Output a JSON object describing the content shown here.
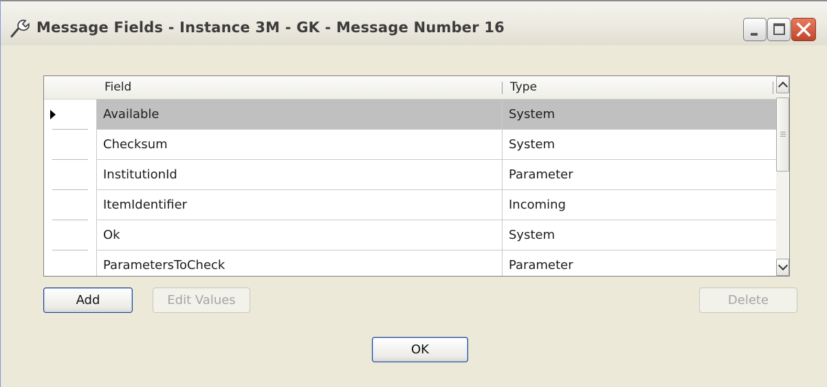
{
  "window": {
    "title": "Message Fields - Instance 3M - GK - Message Number 16",
    "icon": "tools-icon"
  },
  "grid": {
    "columns": [
      "Field",
      "Type"
    ],
    "selected_row": 0,
    "rows": [
      {
        "field": "Available",
        "type": "System"
      },
      {
        "field": "Checksum",
        "type": "System"
      },
      {
        "field": "InstitutionId",
        "type": "Parameter"
      },
      {
        "field": "ItemIdentifier",
        "type": "Incoming"
      },
      {
        "field": "Ok",
        "type": "System"
      },
      {
        "field": "ParametersToCheck",
        "type": "Parameter"
      }
    ]
  },
  "buttons": {
    "add": "Add",
    "edit_values": "Edit Values",
    "delete": "Delete",
    "ok": "OK"
  },
  "colors": {
    "window_bg": "#ece9d8",
    "selected_row": "#c0c0c0",
    "close_button": "#c0452b"
  }
}
